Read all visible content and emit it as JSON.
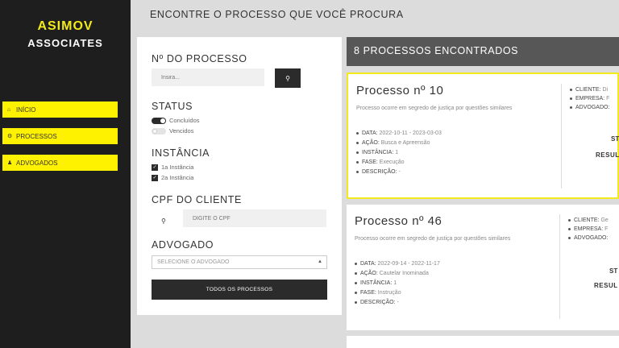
{
  "brand": {
    "line1": "ASIMOV",
    "line2": "ASSOCIATES"
  },
  "nav": [
    {
      "label": "INÍCIO",
      "icon": "home-icon"
    },
    {
      "label": "PROCESSOS",
      "icon": "gear-icon"
    },
    {
      "label": "ADVOGADOS",
      "icon": "users-icon"
    }
  ],
  "header": {
    "title": "ENCONTRE O PROCESSO QUE VOCÊ PROCURA"
  },
  "filters": {
    "process_number_label": "Nº DO PROCESSO",
    "process_number_placeholder": "Insira...",
    "status_label": "STATUS",
    "status_options": [
      {
        "label": "Concluídos",
        "on": true
      },
      {
        "label": "Vencidos",
        "on": false
      }
    ],
    "instance_label": "INSTÂNCIA",
    "instance_options": [
      {
        "label": "1a Instância",
        "checked": true
      },
      {
        "label": "2a Instância",
        "checked": true
      }
    ],
    "cpf_label": "CPF DO CLIENTE",
    "cpf_placeholder": "DIGITE O CPF",
    "lawyer_label": "ADVOGADO",
    "lawyer_placeholder": "SELECIONE O ADVOGADO",
    "all_button": "TODOS OS PROCESSOS"
  },
  "results": {
    "title": "8 PROCESSOS ENCONTRADOS",
    "cards": [
      {
        "title": "Processo nº 10",
        "desc": "Processo ocorre em segredo de justiça por questões similares",
        "data_label": "DATA:",
        "data": "2022-10-11 - 2023-03-03",
        "acao_label": "AÇÃO:",
        "acao": "Busca e Apreensão",
        "instancia_label": "INSTÂNCIA:",
        "instancia": "1",
        "fase_label": "FASE:",
        "fase": "Execução",
        "descricao_label": "DESCRIÇÃO:",
        "descricao": "-",
        "cliente_label": "CLIENTE:",
        "cliente": "Di",
        "empresa_label": "EMPRESA:",
        "empresa": "F",
        "advogado_label": "ADVOGADO:",
        "advogado": "",
        "status": "ST",
        "result": "RESUL"
      },
      {
        "title": "Processo nº 46",
        "desc": "Processo ocorre em segredo de justiça por questões similares",
        "data_label": "DATA:",
        "data": "2022-09-14 - 2022-11-17",
        "acao_label": "AÇÃO:",
        "acao": "Cautelar Inominada",
        "instancia_label": "INSTÂNCIA:",
        "instancia": "1",
        "fase_label": "FASE:",
        "fase": "Instrução",
        "descricao_label": "DESCRIÇÃO:",
        "descricao": "-",
        "cliente_label": "CLIENTE:",
        "cliente": "Ge",
        "empresa_label": "EMPRESA:",
        "empresa": "F",
        "advogado_label": "ADVOGADO:",
        "advogado": "",
        "status": "ST",
        "result": "RESUL"
      }
    ]
  },
  "colors": {
    "accent": "#fff200",
    "brand_yellow": "#f2ea1a",
    "sidebar": "#1e1e1e",
    "dark_button": "#2b2b2b",
    "results_bar": "#575757"
  }
}
